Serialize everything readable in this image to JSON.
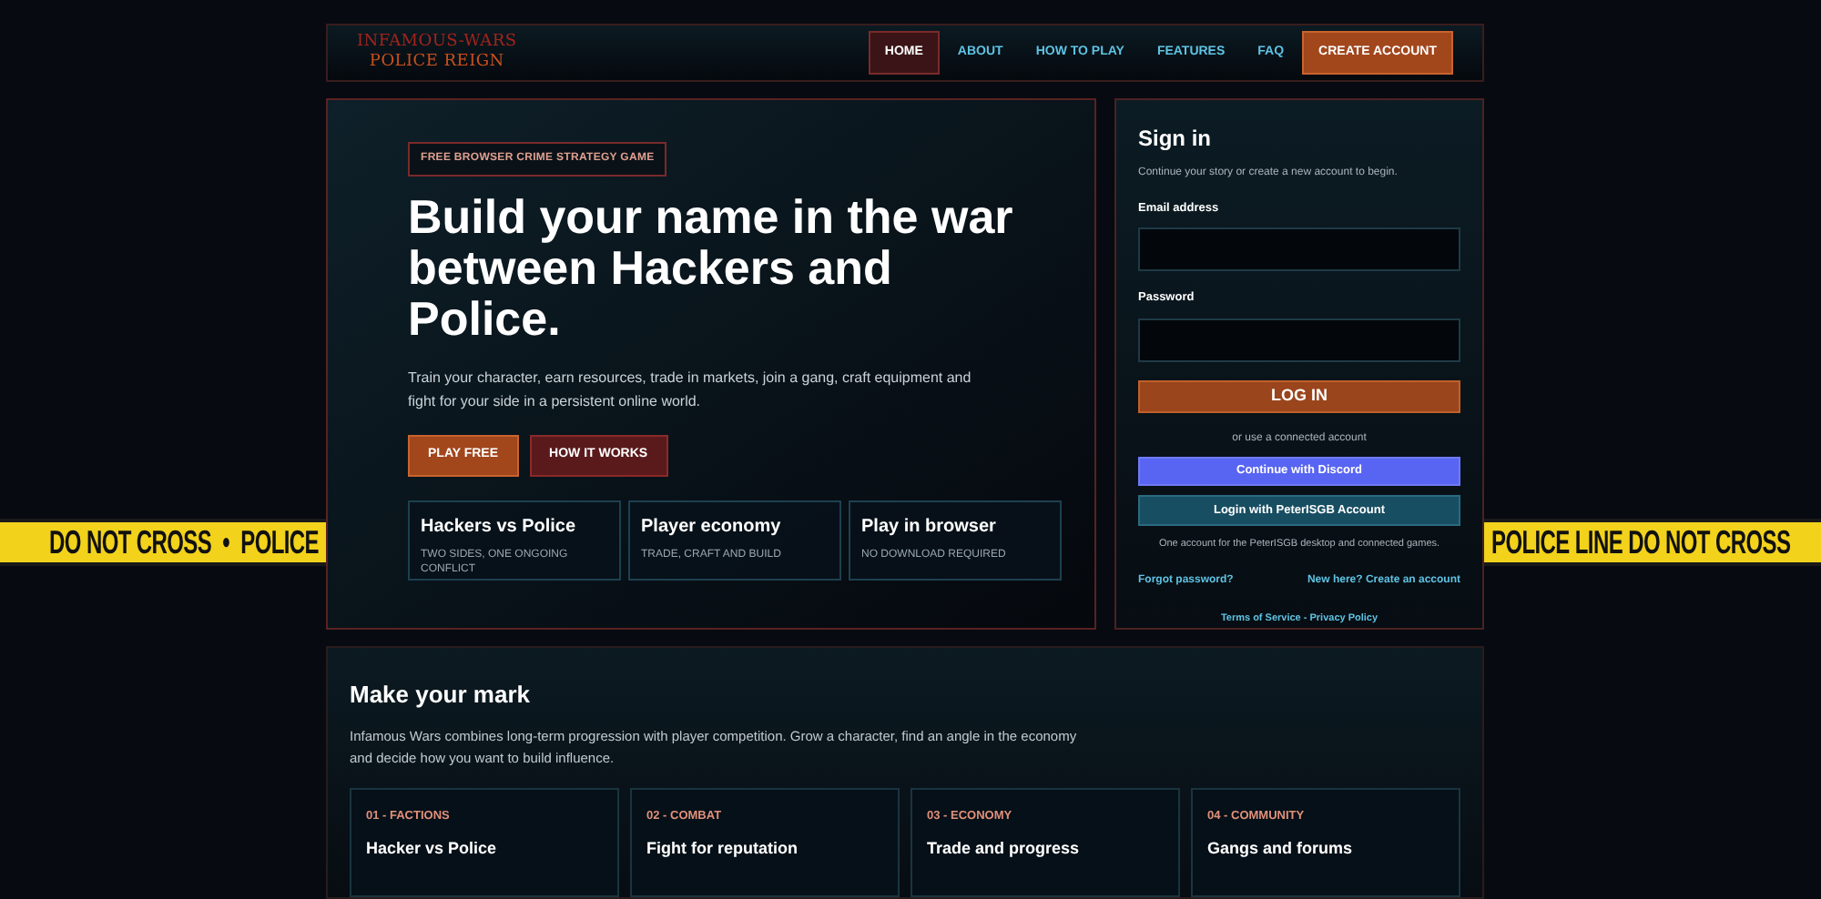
{
  "tape": {
    "left": "DO NOT CROSS  •  POLICE",
    "right": "POLICE LINE DO NOT CROSS"
  },
  "header": {
    "logo": [
      "INFAMOUS-WARS",
      "POLICE REIGN"
    ],
    "nav": [
      {
        "label": "HOME",
        "kind": "link",
        "selected": true
      },
      {
        "label": "ABOUT",
        "kind": "link",
        "selected": false
      },
      {
        "label": "HOW TO PLAY",
        "kind": "link",
        "selected": false
      },
      {
        "label": "FEATURES",
        "kind": "link",
        "selected": false
      },
      {
        "label": "FAQ",
        "kind": "link",
        "selected": false
      },
      {
        "label": "CREATE ACCOUNT",
        "kind": "cta",
        "selected": false
      }
    ]
  },
  "hero": {
    "badge": "FREE BROWSER CRIME STRATEGY GAME",
    "title": "Build your name in the war between Hackers and Police.",
    "description": "Train your character, earn resources, trade in markets, join a gang, craft equipment and fight for your side in a persistent online world.",
    "buttons": [
      {
        "label": "PLAY FREE",
        "kind": "primary"
      },
      {
        "label": "HOW IT WORKS",
        "kind": "secondary"
      }
    ],
    "features": [
      {
        "title": "Hackers vs Police",
        "subtitle": "TWO SIDES, ONE ONGOING CONFLICT"
      },
      {
        "title": "Player economy",
        "subtitle": "TRADE, CRAFT AND BUILD"
      },
      {
        "title": "Play in browser",
        "subtitle": "NO DOWNLOAD REQUIRED"
      }
    ]
  },
  "signin": {
    "title": "Sign in",
    "subtitle": "Continue your story or create a new account to begin.",
    "fields": [
      {
        "label": "Email address"
      },
      {
        "label": "Password"
      }
    ],
    "submit": "LOG IN",
    "divider": "or use a connected account",
    "oauth": [
      {
        "label": "Continue with Discord",
        "kind": "discord"
      },
      {
        "label": "Login with PeterISGB Account",
        "kind": "peter"
      }
    ],
    "note": "One account for the PeterISGB desktop and connected games.",
    "forgot": "Forgot password?",
    "create": "New here? Create an account",
    "legal": "Terms of Service - Privacy Policy"
  },
  "section": {
    "title": "Make your mark",
    "description": "Infamous Wars combines long-term progression with player competition. Grow a character, find an angle in the economy and decide how you want to build influence.",
    "cards": [
      {
        "tag": "01 - FACTIONS",
        "title": "Hacker vs Police"
      },
      {
        "tag": "02 - COMBAT",
        "title": "Fight for reputation"
      },
      {
        "tag": "03 - ECONOMY",
        "title": "Trade and progress"
      },
      {
        "tag": "04 - COMMUNITY",
        "title": "Gangs and forums"
      }
    ]
  }
}
